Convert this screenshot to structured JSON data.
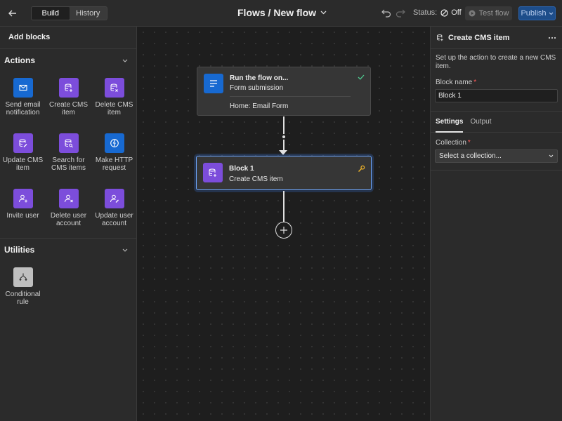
{
  "topbar": {
    "tabs": [
      {
        "label": "Build"
      },
      {
        "label": "History"
      }
    ],
    "title": "Flows / New flow",
    "status_label": "Status:",
    "status_value": "Off",
    "test_label": "Test flow",
    "publish_label": "Publish"
  },
  "left": {
    "header": "Add blocks",
    "sections": [
      {
        "title": "Actions",
        "items": [
          {
            "label": "Send email notification",
            "icon": "mail-icon",
            "color": "#1769d1"
          },
          {
            "label": "Create CMS item",
            "icon": "database-plus-icon",
            "color": "#7c4ddb"
          },
          {
            "label": "Delete CMS item",
            "icon": "database-x-icon",
            "color": "#7c4ddb"
          },
          {
            "label": "Update CMS item",
            "icon": "database-edit-icon",
            "color": "#7c4ddb"
          },
          {
            "label": "Search for CMS items",
            "icon": "database-search-icon",
            "color": "#7c4ddb"
          },
          {
            "label": "Make HTTP request",
            "icon": "globe-icon",
            "color": "#1769d1"
          },
          {
            "label": "Invite user",
            "icon": "user-plus-icon",
            "color": "#7c4ddb"
          },
          {
            "label": "Delete user account",
            "icon": "user-x-icon",
            "color": "#7c4ddb"
          },
          {
            "label": "Update user account",
            "icon": "user-edit-icon",
            "color": "#7c4ddb"
          }
        ]
      },
      {
        "title": "Utilities",
        "items": [
          {
            "label": "Conditional rule",
            "icon": "branch-icon",
            "color": "#bfbfbf"
          }
        ]
      }
    ]
  },
  "canvas": {
    "trigger": {
      "title": "Run the flow on...",
      "subtitle": "Form submission",
      "detail": "Home: Email Form"
    },
    "block": {
      "title": "Block 1",
      "subtitle": "Create CMS item"
    }
  },
  "right": {
    "title": "Create CMS item",
    "description": "Set up the action to create a new CMS item.",
    "block_name_label": "Block name",
    "block_name_value": "Block 1",
    "tabs": [
      {
        "label": "Settings"
      },
      {
        "label": "Output"
      }
    ],
    "collection_label": "Collection",
    "collection_placeholder": "Select a collection..."
  },
  "colors": {
    "accent": "#1769d1",
    "purple": "#7c4ddb",
    "required": "#ff5a5a",
    "publish": "#1d4d8a"
  }
}
